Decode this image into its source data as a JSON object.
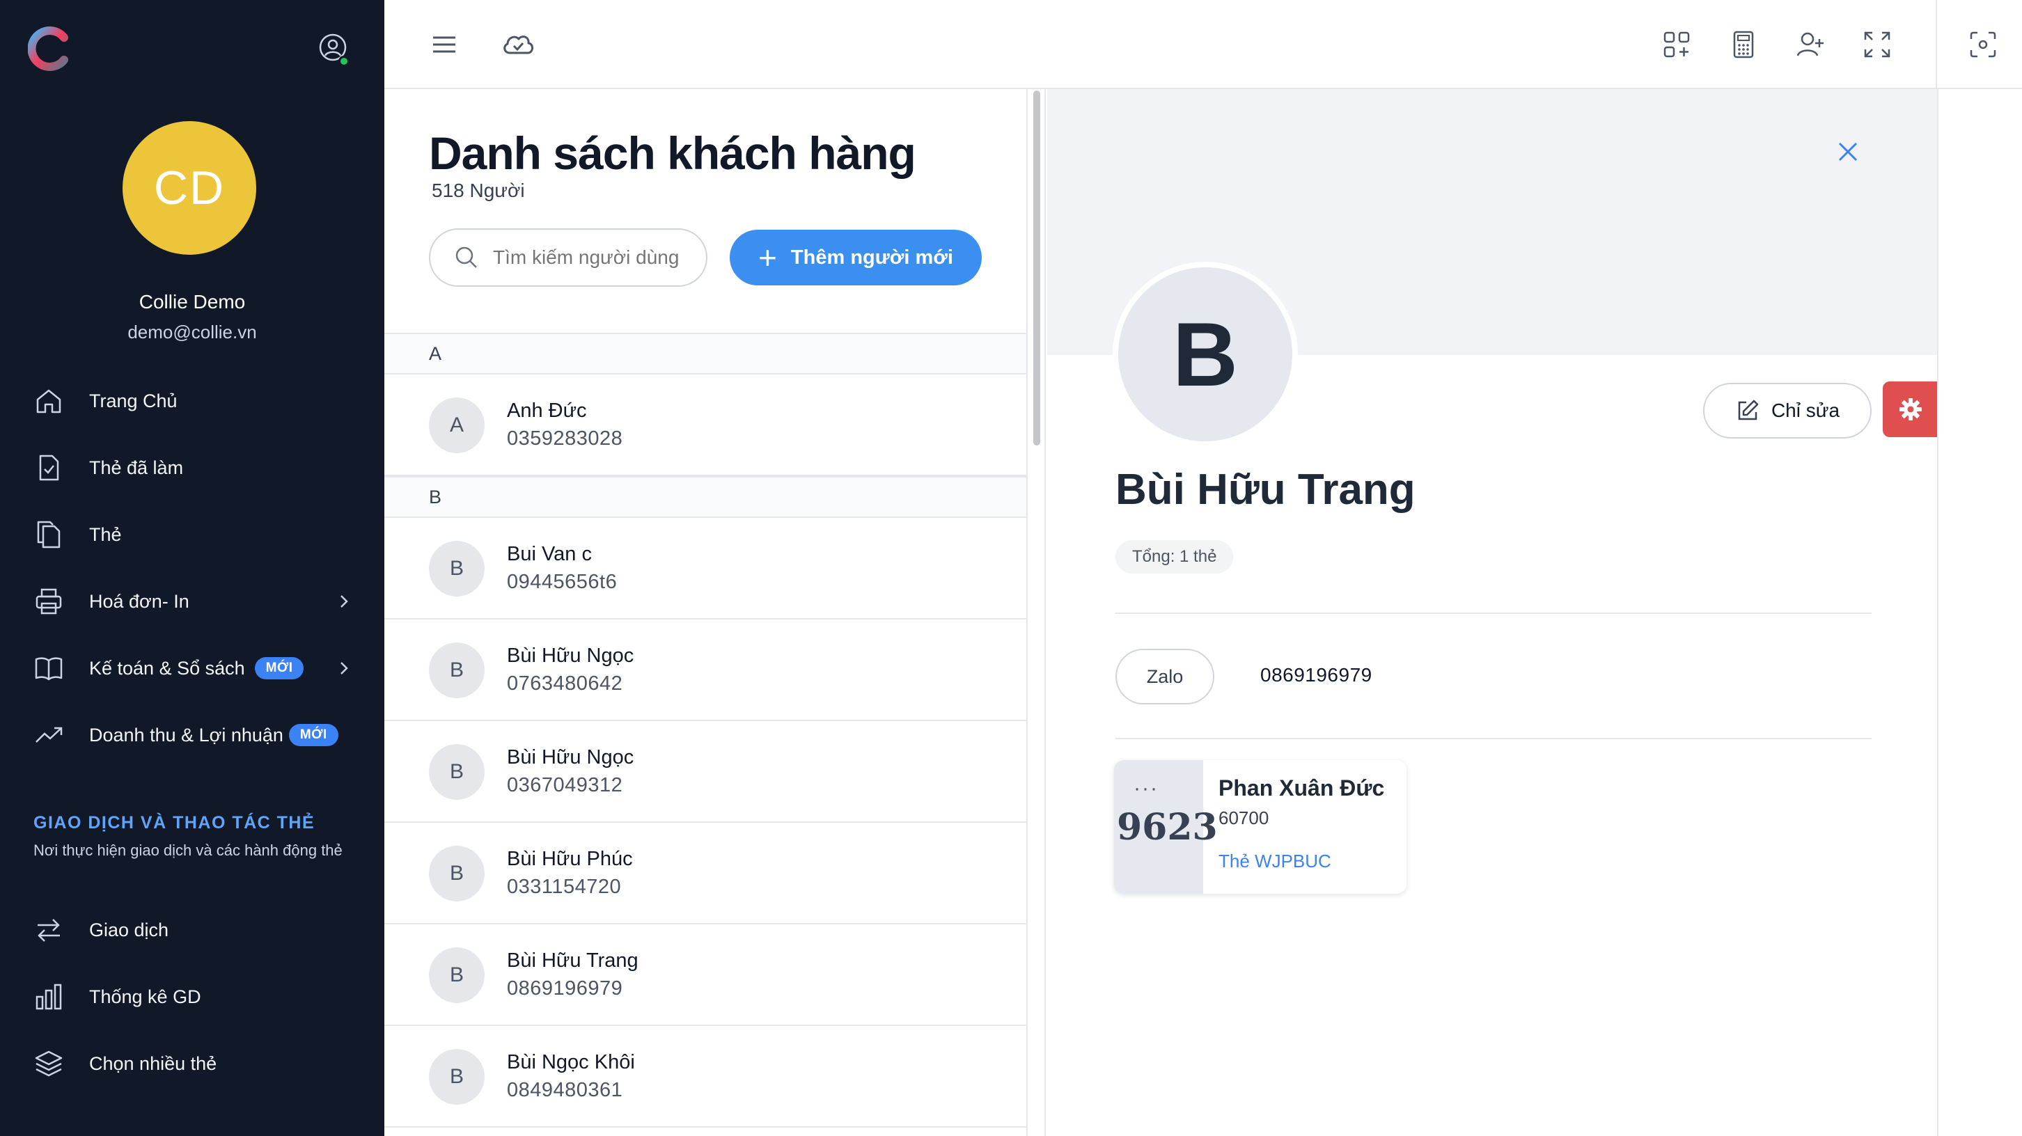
{
  "sidebar": {
    "user": {
      "initials": "CD",
      "name": "Collie Demo",
      "email": "demo@collie.vn"
    },
    "nav": [
      {
        "label": "Trang Chủ",
        "icon": "home-icon"
      },
      {
        "label": "Thẻ đã làm",
        "icon": "file-check-icon"
      },
      {
        "label": "Thẻ",
        "icon": "copy-icon"
      },
      {
        "label": "Hoá đơn- In",
        "icon": "printer-icon"
      },
      {
        "label": "Kế toán & Sổ sách",
        "icon": "book-icon",
        "badge": "MỚI"
      },
      {
        "label": "Doanh thu & Lợi nhuận",
        "icon": "trending-up-icon",
        "badge": "MỚI"
      }
    ],
    "section": {
      "title": "GIAO DỊCH VÀ THAO TÁC THẺ",
      "subtitle": "Nơi thực hiện giao dịch và các hành động thẻ"
    },
    "nav2": [
      {
        "label": "Giao dịch",
        "icon": "swap-icon"
      },
      {
        "label": "Thống kê GD",
        "icon": "bar-chart-icon"
      },
      {
        "label": "Chọn nhiều thẻ",
        "icon": "layers-icon"
      }
    ]
  },
  "list": {
    "title": "Danh sách khách hàng",
    "count": "518 Người",
    "search_placeholder": "Tìm kiếm người dùng",
    "add_label": "Thêm người mới",
    "groups": [
      {
        "letter": "A",
        "rows": [
          {
            "initial": "A",
            "name": "Anh Đức",
            "phone": "0359283028"
          }
        ]
      },
      {
        "letter": "B",
        "rows": [
          {
            "initial": "B",
            "name": "Bui Van c",
            "phone": "09445656t6"
          },
          {
            "initial": "B",
            "name": "Bùi Hữu Ngọc",
            "phone": "0763480642"
          },
          {
            "initial": "B",
            "name": "Bùi Hữu Ngọc",
            "phone": "0367049312"
          },
          {
            "initial": "B",
            "name": "Bùi Hữu Phúc",
            "phone": "0331154720"
          },
          {
            "initial": "B",
            "name": "Bùi Hữu Trang",
            "phone": "0869196979"
          },
          {
            "initial": "B",
            "name": "Bùi Ngọc Khôi",
            "phone": "0849480361"
          }
        ]
      }
    ]
  },
  "detail": {
    "initial": "B",
    "name": "Bùi Hữu Trang",
    "total": "Tổng: 1 thẻ",
    "edit_label": "Chỉ sửa",
    "zalo_label": "Zalo",
    "phone": "0869196979",
    "card": {
      "dots": "···",
      "last4": "9623",
      "holder": "Phan Xuân Đức",
      "amount": "60700",
      "code": "Thẻ WJPBUC"
    }
  },
  "colors": {
    "sidebar": "#111827",
    "accent": "#3b8ff0",
    "avatar": "#ecc53a",
    "danger": "#e04f4f"
  }
}
